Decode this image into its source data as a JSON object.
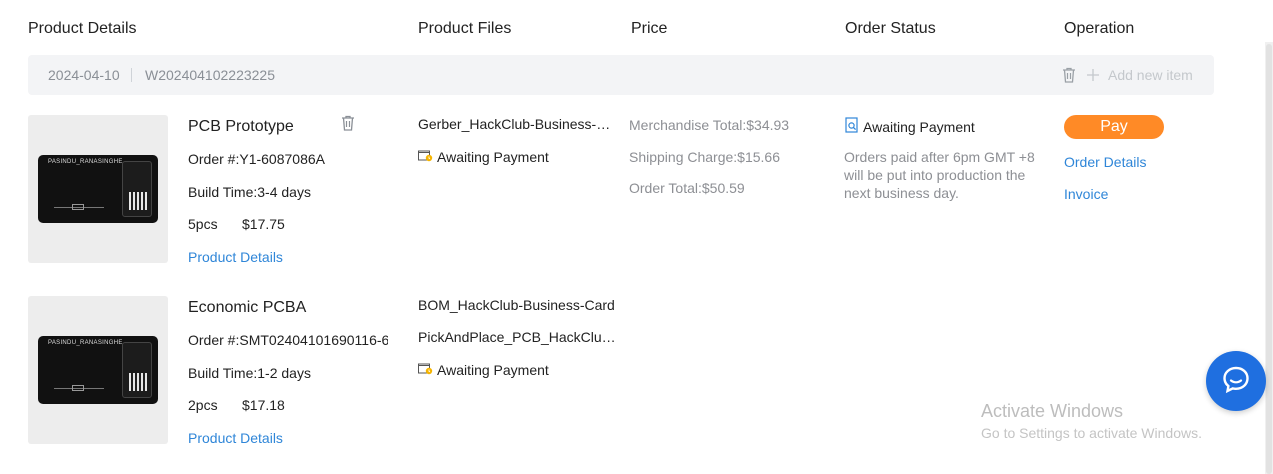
{
  "headers": {
    "product_details": "Product Details",
    "product_files": "Product Files",
    "price": "Price",
    "order_status": "Order Status",
    "operation": "Operation"
  },
  "group": {
    "date": "2024-04-10",
    "order_id": "W202404102223225",
    "add_new_item": "Add new item"
  },
  "items": [
    {
      "title": "PCB Prototype",
      "order_no": "Order #:Y1-6087086A",
      "build_time": "Build Time:3-4 days",
      "qty": "5pcs",
      "price": "$17.75",
      "details_link": "Product Details",
      "board_label": "PASINDU_RANASINGHE",
      "files": [
        "Gerber_HackClub-Business-Card"
      ],
      "file_status": "Awaiting Payment"
    },
    {
      "title": "Economic PCBA",
      "order_no": "Order #:SMT02404101690116-6",
      "build_time": "Build Time:1-2 days",
      "qty": "2pcs",
      "price": "$17.18",
      "details_link": "Product Details",
      "board_label": "PASINDU_RANASINGHE",
      "files": [
        "BOM_HackClub-Business-Card",
        "PickAndPlace_PCB_HackClub-Business-Card"
      ],
      "file_status": "Awaiting Payment"
    }
  ],
  "pricing": {
    "merchandise": "Merchandise Total:$34.93",
    "shipping": "Shipping Charge:$15.66",
    "total": "Order Total:$50.59"
  },
  "order_status": {
    "status": "Awaiting Payment",
    "note": "Orders paid after 6pm GMT +8 will be put into production the next business day."
  },
  "operation": {
    "pay": "Pay",
    "order_details": "Order Details",
    "invoice": "Invoice"
  },
  "watermark": {
    "title": "Activate Windows",
    "subtitle": "Go to Settings to activate Windows."
  },
  "colors": {
    "accent_orange": "#ff8a26",
    "link_blue": "#2f86d8",
    "chat_blue": "#1f6fe0"
  }
}
